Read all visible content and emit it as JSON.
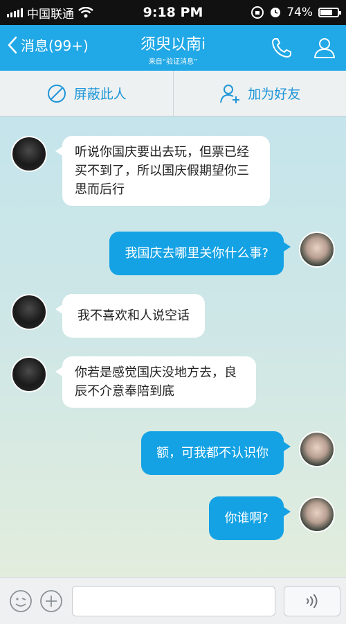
{
  "status_bar": {
    "carrier": "中国联通",
    "time": "9:18 PM",
    "battery": "74%",
    "battery_level": 0.74
  },
  "nav": {
    "back_label": "消息(99+)",
    "title": "须臾以南i",
    "subtitle": "来自“验证消息”"
  },
  "actions": {
    "block_label": "屏蔽此人",
    "add_friend_label": "加为好友"
  },
  "messages": [
    {
      "side": "in",
      "text": "听说你国庆要出去玩，但票已经买不到了，所以国庆假期望你三思而后行"
    },
    {
      "side": "out",
      "text": "我国庆去哪里关你什么事?"
    },
    {
      "side": "in",
      "text": "我不喜欢和人说空话"
    },
    {
      "side": "in",
      "text": "你若是感觉国庆没地方去，良辰不介意奉陪到底"
    },
    {
      "side": "out",
      "text": "额，可我都不认识你"
    },
    {
      "side": "out",
      "text": "你谁啊?"
    }
  ],
  "input": {
    "value": "",
    "placeholder": ""
  },
  "colors": {
    "accent": "#21a8e6",
    "bubble_out": "#14a2e4",
    "action_text": "#1e96d8"
  }
}
